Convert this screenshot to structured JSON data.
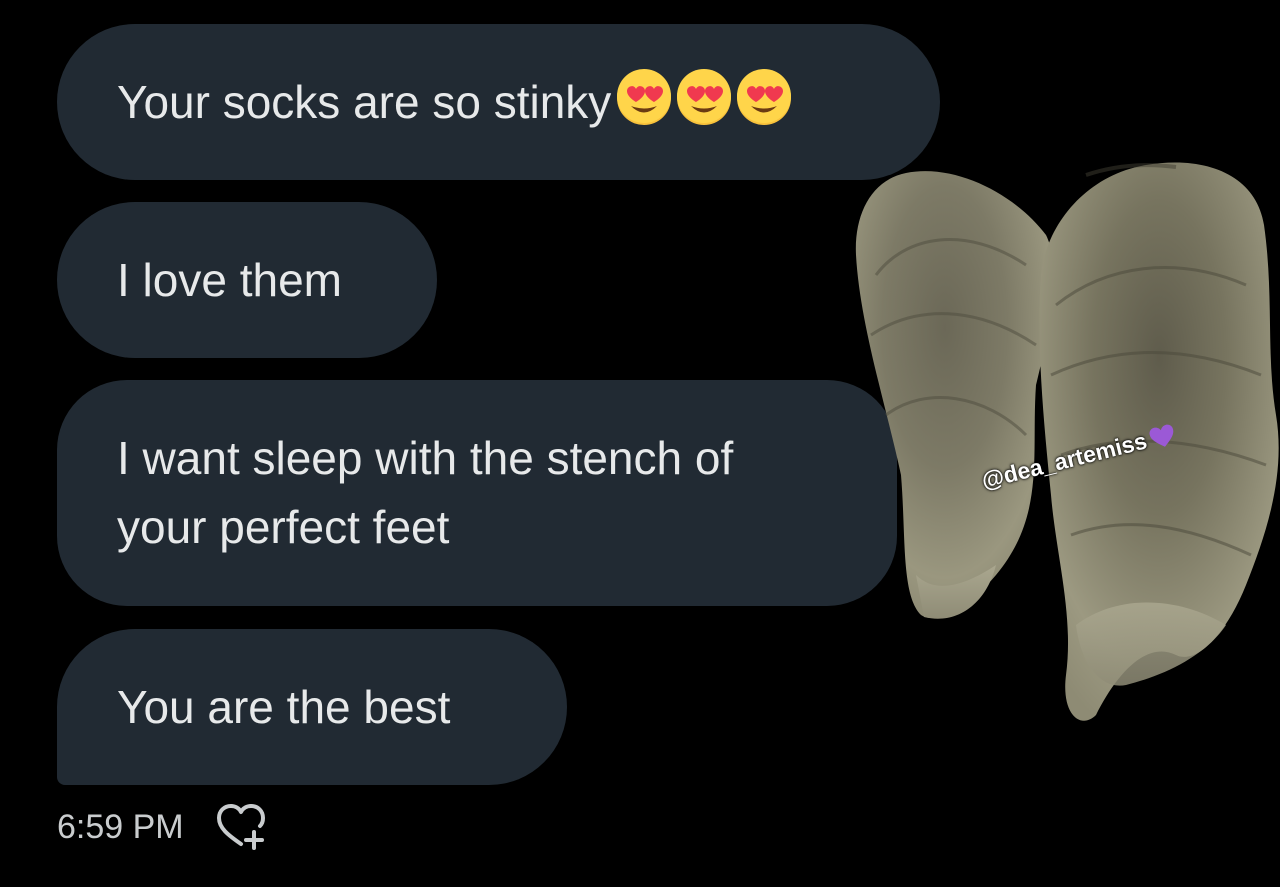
{
  "messages": [
    {
      "text": "Your socks are so stinky",
      "emojis": [
        "heart-eyes-emoji",
        "heart-eyes-emoji",
        "heart-eyes-emoji"
      ]
    },
    {
      "text": "I love them"
    },
    {
      "text": "I want sleep with the stench of\nyour perfect feet"
    },
    {
      "text": "You are the best"
    }
  ],
  "meta": {
    "timestamp": "6:59 PM",
    "react_icon": "heart-plus-icon"
  },
  "overlay": {
    "watermark": "@dea_artemiss",
    "watermark_icon": "purple-heart-icon",
    "photo": "dirty-socks-photo"
  },
  "colors": {
    "background": "#000000",
    "bubble": "#212a33",
    "text": "#e7e9ea",
    "muted": "#c9ccce",
    "purple_heart": "#9b59d6"
  }
}
